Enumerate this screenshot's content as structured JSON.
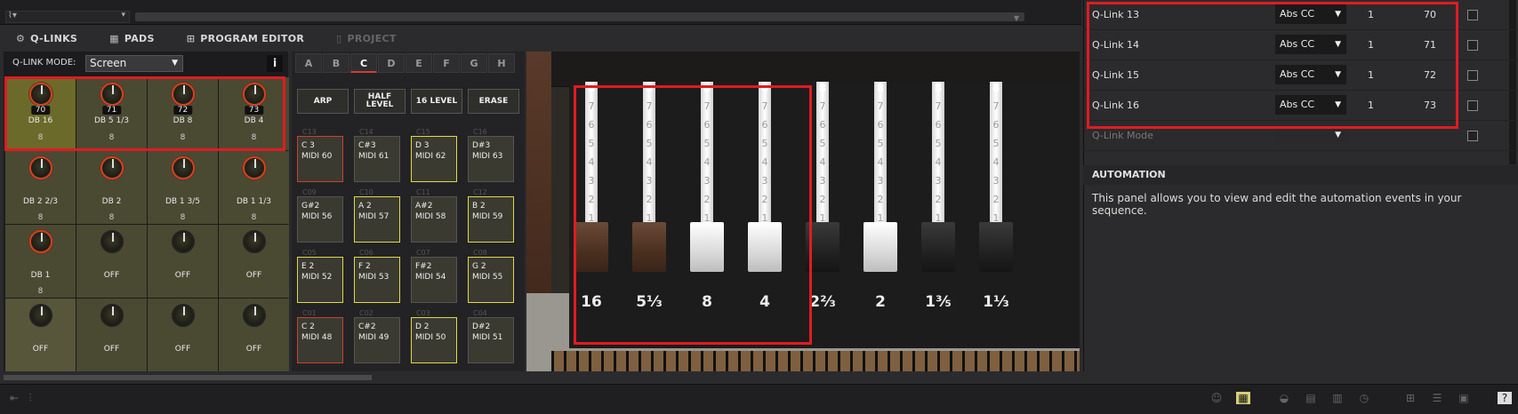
{
  "tabs": [
    {
      "label": "Q-LINKS",
      "icon": "qlinks-icon"
    },
    {
      "label": "PADS",
      "icon": "pads-icon"
    },
    {
      "label": "PROGRAM EDITOR",
      "icon": "grid-icon"
    },
    {
      "label": "PROJECT",
      "icon": "document-icon"
    }
  ],
  "qlink_mode": {
    "label": "Q-LINK MODE:",
    "value": "Screen",
    "info": "i"
  },
  "knobs": [
    {
      "value": "70",
      "name": "DB 16",
      "num": "8"
    },
    {
      "value": "71",
      "name": "DB 5 1/3",
      "num": "8"
    },
    {
      "value": "72",
      "name": "DB 8",
      "num": "8"
    },
    {
      "value": "73",
      "name": "DB 4",
      "num": "8"
    },
    {
      "name": "DB 2 2/3",
      "num": "8"
    },
    {
      "name": "DB 2",
      "num": "8"
    },
    {
      "name": "DB 1 3/5",
      "num": "8"
    },
    {
      "name": "DB 1 1/3",
      "num": "8"
    },
    {
      "name": "DB 1",
      "num": "8"
    },
    {
      "name": "OFF"
    },
    {
      "name": "OFF"
    },
    {
      "name": "OFF"
    },
    {
      "name": "OFF"
    },
    {
      "name": "OFF"
    },
    {
      "name": "OFF"
    },
    {
      "name": "OFF"
    }
  ],
  "pad_banks": [
    "A",
    "B",
    "C",
    "D",
    "E",
    "F",
    "G",
    "H"
  ],
  "active_bank": "C",
  "pad_buttons": [
    "ARP",
    "HALF LEVEL",
    "16 LEVEL",
    "ERASE"
  ],
  "pads": [
    {
      "num": "C13",
      "note": "C 3",
      "midi": "MIDI 60",
      "style": "r"
    },
    {
      "num": "C14",
      "note": "C#3",
      "midi": "MIDI 61",
      "style": ""
    },
    {
      "num": "C15",
      "note": "D 3",
      "midi": "MIDI 62",
      "style": "y"
    },
    {
      "num": "C16",
      "note": "D#3",
      "midi": "MIDI 63",
      "style": ""
    },
    {
      "num": "C09",
      "note": "G#2",
      "midi": "MIDI 56",
      "style": ""
    },
    {
      "num": "C10",
      "note": "A 2",
      "midi": "MIDI 57",
      "style": "y"
    },
    {
      "num": "C11",
      "note": "A#2",
      "midi": "MIDI 58",
      "style": ""
    },
    {
      "num": "C12",
      "note": "B 2",
      "midi": "MIDI 59",
      "style": "y"
    },
    {
      "num": "C05",
      "note": "E 2",
      "midi": "MIDI 52",
      "style": "y"
    },
    {
      "num": "C06",
      "note": "F 2",
      "midi": "MIDI 53",
      "style": "y"
    },
    {
      "num": "C07",
      "note": "F#2",
      "midi": "MIDI 54",
      "style": ""
    },
    {
      "num": "C08",
      "note": "G 2",
      "midi": "MIDI 55",
      "style": "y"
    },
    {
      "num": "C01",
      "note": "C 2",
      "midi": "MIDI 48",
      "style": "r"
    },
    {
      "num": "C02",
      "note": "C#2",
      "midi": "MIDI 49",
      "style": ""
    },
    {
      "num": "C03",
      "note": "D 2",
      "midi": "MIDI 50",
      "style": "y"
    },
    {
      "num": "C04",
      "note": "D#2",
      "midi": "MIDI 51",
      "style": ""
    }
  ],
  "drawbar_scale": [
    "8",
    "7",
    "6",
    "5",
    "4",
    "3",
    "2",
    "1"
  ],
  "drawbars": [
    {
      "label": "16",
      "handle": "brown",
      "level": 8
    },
    {
      "label": "5⅓",
      "handle": "brown",
      "level": 8
    },
    {
      "label": "8",
      "handle": "white",
      "level": 8
    },
    {
      "label": "4",
      "handle": "white",
      "level": 8
    },
    {
      "label": "2⅔",
      "handle": "black",
      "level": 8
    },
    {
      "label": "2",
      "handle": "white",
      "level": 8
    },
    {
      "label": "1⅗",
      "handle": "black",
      "level": 8
    },
    {
      "label": "1⅓",
      "handle": "black",
      "level": 8
    }
  ],
  "qlink_rows": [
    {
      "name": "Q-Link 13",
      "type": "Abs CC",
      "channel": "1",
      "cc": "70"
    },
    {
      "name": "Q-Link 14",
      "type": "Abs CC",
      "channel": "1",
      "cc": "71"
    },
    {
      "name": "Q-Link 15",
      "type": "Abs CC",
      "channel": "1",
      "cc": "72"
    },
    {
      "name": "Q-Link 16",
      "type": "Abs CC",
      "channel": "1",
      "cc": "73"
    },
    {
      "name": "Q-Link Mode",
      "type": "",
      "channel": "",
      "cc": ""
    }
  ],
  "automation": {
    "title": "AUTOMATION",
    "text": "This panel allows you to view and edit the automation events in your sequence."
  },
  "colors": {
    "highlight": "#e11b22",
    "pad_yellow": "#e0d84a",
    "pad_red": "#c94230",
    "knob_ring": "#c84624"
  }
}
